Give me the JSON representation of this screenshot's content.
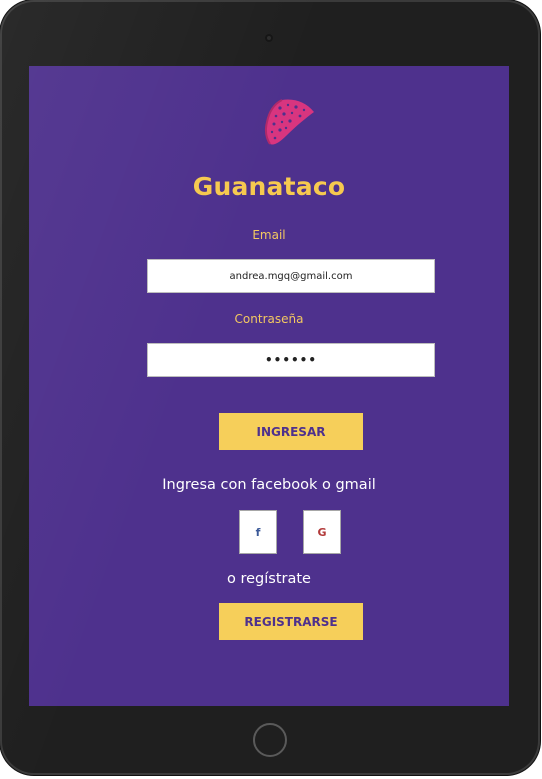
{
  "app": {
    "title": "Guanataco"
  },
  "form": {
    "email_label": "Email",
    "email_value": "andrea.mgq@gmail.com",
    "password_label": "Contraseña",
    "password_value": "••••••",
    "login_button": "INGRESAR"
  },
  "social": {
    "prompt": "Ingresa con facebook o gmail",
    "facebook_icon_text": "f",
    "google_icon_text": "G"
  },
  "register": {
    "prompt": "o regístrate",
    "button": "REGISTRARSE"
  },
  "colors": {
    "screen_bg": "#4e318d",
    "accent_yellow": "#f6cf5a",
    "logo_pink": "#d8357f"
  },
  "icons": {
    "logo": "taco-logo-icon",
    "facebook": "facebook-icon",
    "google": "google-icon"
  }
}
